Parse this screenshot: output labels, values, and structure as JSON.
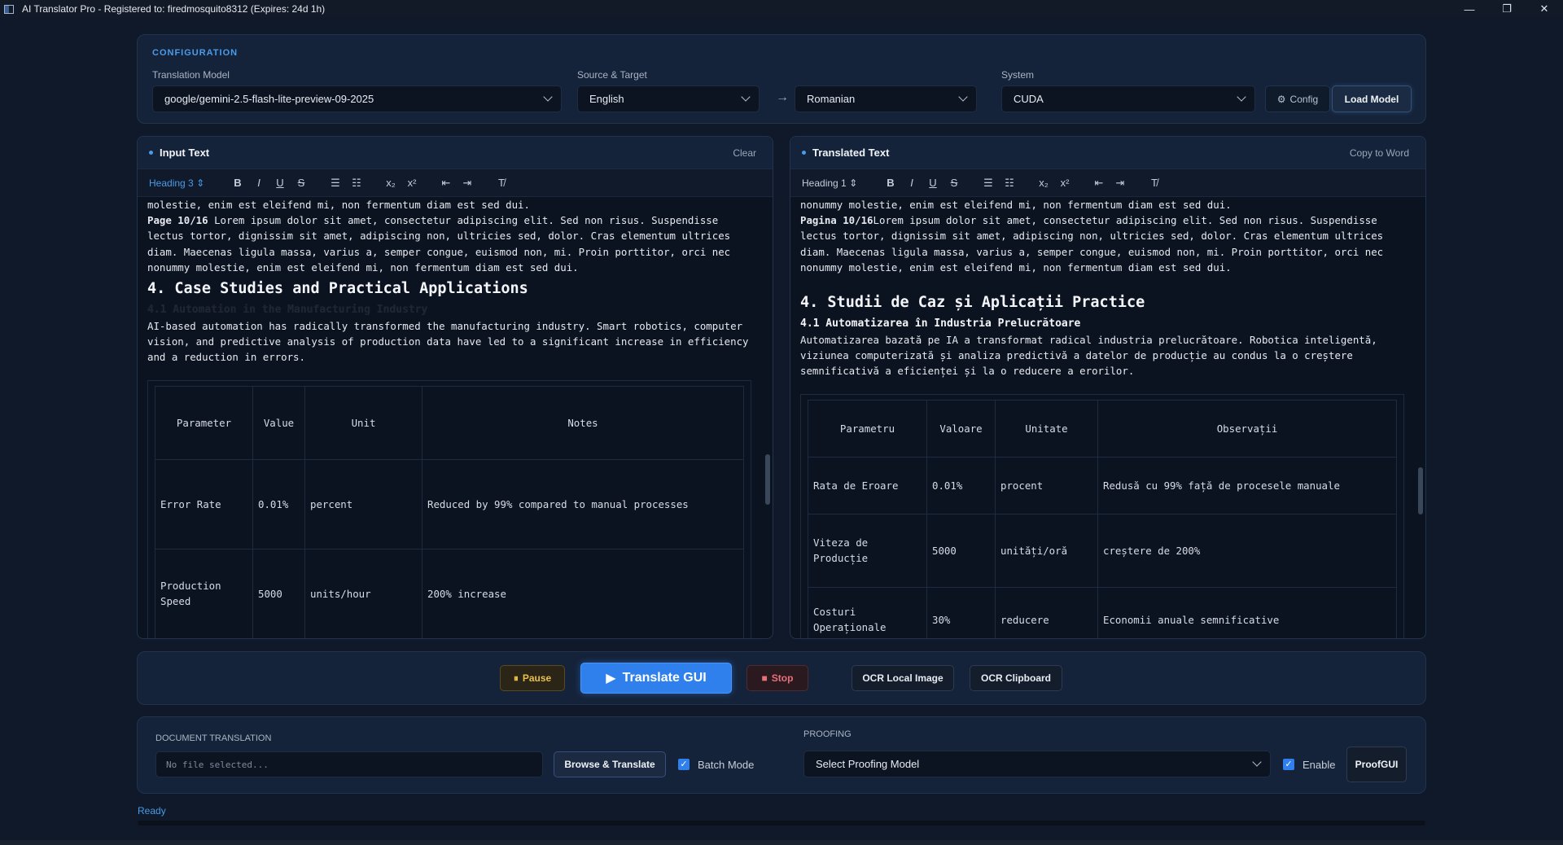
{
  "window": {
    "title": "AI Translator Pro - Registered to: firedmosquito8312 (Expires: 24d 1h)",
    "minimize": "—",
    "restore": "❐",
    "close": "✕"
  },
  "config": {
    "section_title": "CONFIGURATION",
    "model_label": "Translation Model",
    "model_value": "google/gemini-2.5-flash-lite-preview-09-2025",
    "source_target_label": "Source & Target",
    "source_value": "English",
    "arrow": "→",
    "target_value": "Romanian",
    "system_label": "System",
    "system_value": "CUDA",
    "config_button": "Config",
    "load_button": "Load Model"
  },
  "input": {
    "title": "Input Text",
    "action": "Clear",
    "heading_select": "Heading 3",
    "lines": {
      "p1": "molestie, enim est eleifend mi, non fermentum diam est sed dui.",
      "p2_bold": "Page 10/16",
      "p2_text": " Lorem ipsum dolor sit amet, consectetur adipiscing elit. Sed non risus. Suspendisse lectus tortor, dignissim sit amet, adipiscing non, ultricies sed, dolor. Cras elementum ultrices diam. Maecenas ligula massa, varius a, semper congue, euismod non, mi. Proin porttitor, orci nec nonummy molestie, enim est eleifend mi, non fermentum diam est sed dui.",
      "h2": "4. Case Studies and Practical Applications",
      "h3": "4.1 Automation in the Manufacturing Industry",
      "p3": "AI-based automation has radically transformed the manufacturing industry. Smart robotics, computer vision, and predictive analysis of production data have led to a significant increase in efficiency and a reduction in errors."
    },
    "table": {
      "headers": [
        "Parameter",
        "Value",
        "Unit",
        "Notes"
      ],
      "rows": [
        [
          "Error Rate",
          "0.01%",
          "percent",
          "Reduced by 99% compared to manual processes"
        ],
        [
          "Production Speed",
          "5000",
          "units/hour",
          "200% increase"
        ]
      ]
    }
  },
  "output": {
    "title": "Translated Text",
    "action": "Copy to Word",
    "heading_select": "Heading 1",
    "lines": {
      "p1": "nonummy molestie, enim est eleifend mi, non fermentum diam est sed dui.",
      "p2_bold": "Pagina 10/16",
      "p2_text": "Lorem ipsum dolor sit amet, consectetur adipiscing elit. Sed non risus. Suspendisse lectus tortor, dignissim sit amet, adipiscing non, ultricies sed, dolor. Cras elementum ultrices diam. Maecenas ligula massa, varius a, semper congue, euismod non, mi. Proin porttitor, orci nec nonummy molestie, enim est eleifend mi, non fermentum diam est sed dui.",
      "h2": "4. Studii de Caz și Aplicații Practice",
      "h3": "4.1 Automatizarea în Industria Prelucrătoare",
      "p3": "Automatizarea bazată pe IA a transformat radical industria prelucrătoare. Robotica inteligentă, viziunea computerizată și analiza predictivă a datelor de producție au condus la o creștere semnificativă a eficienței și la o reducere a erorilor."
    },
    "table": {
      "headers": [
        "Parametru",
        "Valoare",
        "Unitate",
        "Observații"
      ],
      "rows": [
        [
          "Rata de Eroare",
          "0.01%",
          "procent",
          "Redusă cu 99% față de procesele manuale"
        ],
        [
          "Viteza de Producție",
          "5000",
          "unități/oră",
          "creștere de 200%"
        ],
        [
          "Costuri Operaționale",
          "30%",
          "reducere",
          "Economii anuale semnificative"
        ]
      ]
    }
  },
  "toolbar_icons": {
    "bold": "B",
    "italic": "I",
    "underline": "U",
    "strike": "S",
    "ol": "☰",
    "ul": "☷",
    "sub": "x₂",
    "sup": "x²",
    "outdent": "⇤",
    "indent": "⇥",
    "clear": "T̸"
  },
  "actions": {
    "pause": "Pause",
    "translate": "Translate GUI",
    "stop": "Stop",
    "ocr_local": "OCR Local Image",
    "ocr_clipboard": "OCR Clipboard"
  },
  "document": {
    "title": "DOCUMENT TRANSLATION",
    "file_placeholder": "No file selected...",
    "browse_button": "Browse & Translate",
    "batch_label": "Batch Mode",
    "proofing_title": "PROOFING",
    "proofing_model": "Select Proofing Model",
    "enable_label": "Enable",
    "proof_line1": "Proof",
    "proof_line2": "GUI"
  },
  "status": {
    "text": "Ready"
  },
  "colors": {
    "accent": "#2f80ed",
    "background": "#0f1929",
    "panel": "#15233a"
  }
}
